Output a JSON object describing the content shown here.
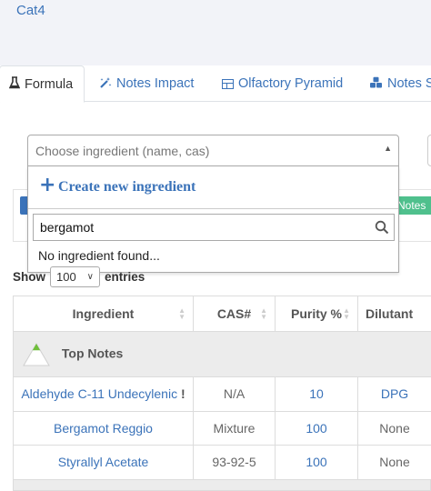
{
  "header": {
    "title": "Cat4"
  },
  "tabs": [
    {
      "label": "Formula",
      "icon": "flask-icon",
      "active": true
    },
    {
      "label": "Notes Impact",
      "icon": "magic-wand-icon"
    },
    {
      "label": "Olfactory Pyramid",
      "icon": "table-icon"
    },
    {
      "label": "Notes S",
      "icon": "cubes-icon"
    }
  ],
  "behind": {
    "green_badge": "Notes"
  },
  "ingredient_select": {
    "placeholder": "Choose ingredient (name, cas)",
    "create_label": "Create new ingredient",
    "search_value": "bergamot",
    "no_result": "No ingredient found..."
  },
  "entries": {
    "show_label": "Show",
    "value": "100",
    "suffix": "entries"
  },
  "table": {
    "columns": [
      "Ingredient",
      "CAS#",
      "Purity %",
      "Dilutant"
    ],
    "group": {
      "label": "Top Notes",
      "color": "#6fbf3a"
    },
    "rows": [
      {
        "ingredient": "Aldehyde C-11 Undecylenic",
        "flag": "!",
        "cas": "N/A",
        "purity": "10",
        "dilutant": "DPG"
      },
      {
        "ingredient": "Bergamot Reggio",
        "cas": "Mixture",
        "purity": "100",
        "dilutant": "None"
      },
      {
        "ingredient": "Styrallyl Acetate",
        "cas": "93-92-5",
        "purity": "100",
        "dilutant": "None"
      }
    ]
  },
  "colors": {
    "link": "#3b73b9",
    "header_bg": "#f2f3f8",
    "group_bg": "#ececec",
    "badge_green": "#4fc08d"
  }
}
